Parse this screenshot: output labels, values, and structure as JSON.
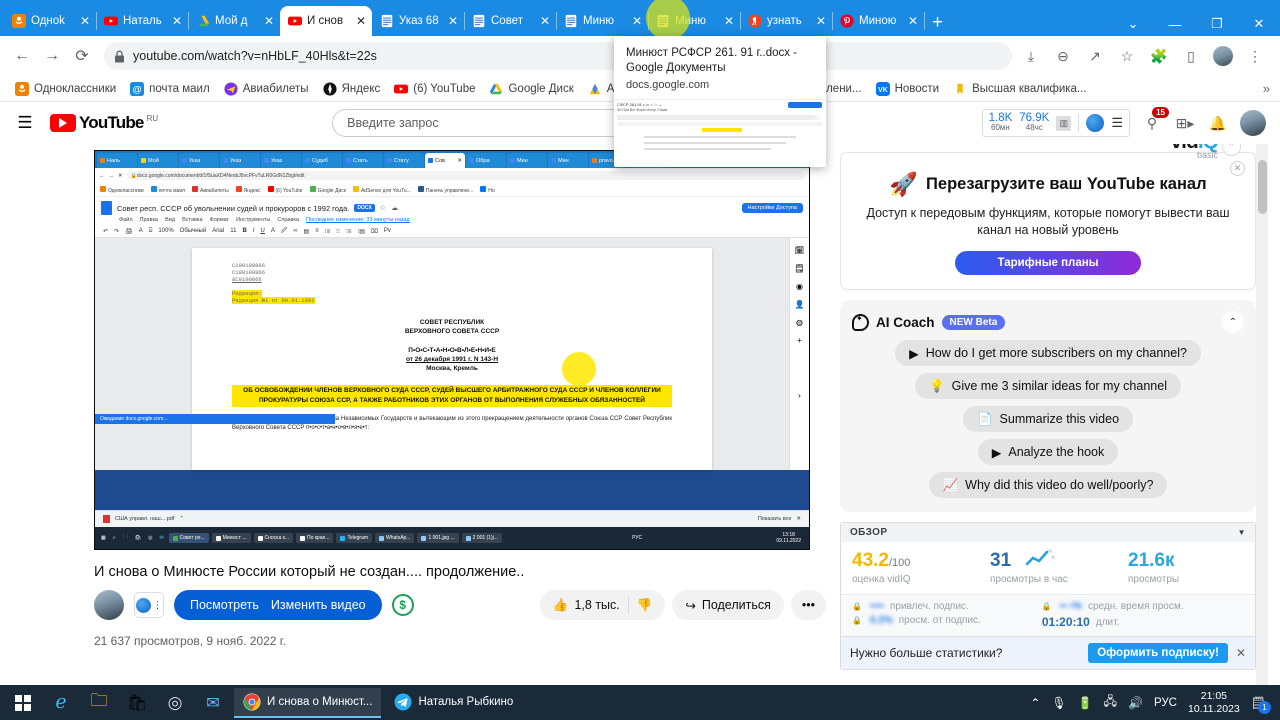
{
  "browser": {
    "tabs": [
      {
        "title": "Одноk",
        "icon": "ok-icon"
      },
      {
        "title": "Наталь",
        "icon": "youtube-icon"
      },
      {
        "title": "Мой д",
        "icon": "gdrive-icon"
      },
      {
        "title": "И снов",
        "icon": "youtube-icon",
        "active": true
      },
      {
        "title": "Указ 68",
        "icon": "gdocs-icon"
      },
      {
        "title": "Совет",
        "icon": "gdocs-icon"
      },
      {
        "title": "Миню",
        "icon": "gdocs-icon",
        "hovered": true
      },
      {
        "title": "Миню",
        "icon": "gdocs-icon"
      },
      {
        "title": "узнать",
        "icon": "yandex-icon"
      },
      {
        "title": "Миною",
        "icon": "pinterest-icon"
      }
    ],
    "new_tab_label": "+",
    "window_controls": [
      "⌄",
      "—",
      "❐",
      "✕"
    ],
    "url": "youtube.com/watch?v=nHbLF_40Hls&t=22s",
    "nav": {
      "back": "←",
      "forward": "→",
      "reload": "⟳",
      "lock": "🔒"
    },
    "toolbar_icons": [
      "downloads-icon",
      "zoom-out-icon",
      "share-icon",
      "bookmark-star-icon",
      "extensions-icon",
      "sidepanel-icon",
      "profile-avatar",
      "chrome-menu-icon"
    ],
    "bookmarks": [
      {
        "label": "Одноклассники",
        "icon": "ok-icon"
      },
      {
        "label": "почта маил",
        "icon": "mail-icon"
      },
      {
        "label": "Авиабилеты",
        "icon": "plane-icon"
      },
      {
        "label": "Яндекс",
        "icon": "yandex-icon"
      },
      {
        "label": "(6) YouTube",
        "icon": "youtube-icon"
      },
      {
        "label": "Google Диск",
        "icon": "gdrive-icon"
      },
      {
        "label": "Adsense для YouTu...",
        "icon": "adsense-icon"
      },
      {
        "label": "Панель управлени...",
        "icon": "panel-icon"
      },
      {
        "label": "Новости",
        "icon": "vk-icon"
      },
      {
        "label": "Высшая квалифика...",
        "icon": "bookmark-icon"
      }
    ],
    "bookmarks_overflow": "»"
  },
  "tab_preview": {
    "title": "Минюст РСФСР 261. 91 г..docx - Google Документы",
    "url": "docs.google.com"
  },
  "youtube": {
    "menu_icon": "hamburger-icon",
    "logo_text": "YouTube",
    "logo_region": "RU",
    "search_placeholder": "Введите запрос",
    "search_value": "",
    "vidiq_stats": [
      {
        "value": "1.8K",
        "label": "60мн"
      },
      {
        "value": "76.9K",
        "label": "48чс"
      }
    ],
    "header_icons": [
      "vidiq-chart-icon",
      "vidiq-logo-icon",
      "vidiq-menu-icon",
      "upload-icon",
      "create-video-icon",
      "notifications-icon",
      "account-avatar"
    ],
    "notification_count": "15"
  },
  "video": {
    "title": "И снова о Минюсте России который не создан.... продолжение..",
    "watch_button": "Посмотреть",
    "edit_button": "Изменить видео",
    "monetize_icon": "dollar-icon",
    "likes": "1,8 тыс.",
    "dislike_icon": "thumbs-down-icon",
    "share_label": "Поделиться",
    "more_icon": "more-horizontal-icon",
    "views_line": "21 637 просмотров, 9 нояб. 2022 г."
  },
  "inner_recording": {
    "tabs": [
      "Наль",
      "Мой",
      "Указ",
      "Указ",
      "Указ",
      "Судеб",
      "Стать",
      "Стату",
      "Сов",
      "Обра",
      "Мин",
      "Мин",
      "pravo.",
      "Уп"
    ],
    "url": "docs.google.com/document/d/1fSuaXD4NeobJ5vcPFvTuLR0GdN1Zbgl/edit",
    "bookmarks": [
      "Одноклассники",
      "почта маил",
      "Авиабилеты",
      "Яндекс",
      "(6) YouTube",
      "Google Диск",
      "AdSense для YouTu...",
      "Панель управлени...",
      "Но"
    ],
    "doc_title": "Совет респ. СССР об увольнении судей и прокуроров с 1992 года.",
    "doc_badge": "DOCX",
    "doc_menus": [
      "Файл",
      "Правка",
      "Вид",
      "Вставка",
      "Формат",
      "Инструменты",
      "Справка"
    ],
    "doc_last_edit": "Последнее изменение: 33 минуты назад",
    "ribbon": [
      "↶",
      "↷",
      "🖨",
      "A",
      "⌸",
      "100%",
      "Обычный",
      "Arial",
      "11",
      "B",
      "I",
      "U",
      "A",
      "🖉",
      "∞",
      "▤",
      "≡",
      "⁝≡",
      "⁝⁝",
      "⁝≡",
      "⁝▤",
      "⌧",
      "Pv"
    ],
    "share_button": "Настройки Доступа",
    "doc_codes": [
      "C199100866",
      "C199100866",
      "&C9100866"
    ],
    "doc_edition": [
      "Редакция:",
      "Редакция №1 от 09.01.1992"
    ],
    "doc_heading": [
      "СОВЕТ РЕСПУБЛИК",
      "ВЕРХОВНОГО СОВЕТА СССР"
    ],
    "doc_post": "П•О•С•Т•А•Н•О•В•Л•Е•Н•И•Е",
    "doc_date": "от 26 декабря 1991 г. N 143-Н",
    "doc_place": "Москва, Кремль",
    "doc_subject": "ОБ ОСВОБОЖДЕНИИ ЧЛЕНОВ ВЕРХОВНОГО СУДА СССР, СУДЕЙ ВЫСШЕГО АРБИТРАЖНОГО СУДА СССР  И ЧЛЕНОВ КОЛЛЕГИИ ПРОКУРАТУРЫ СОЮЗА ССР, А ТАКЖЕ РАБОТНИКОВ ЭТИХ ОРГАНОВ ОТ ВЫПОЛНЕНИЯ СЛУЖЕБНЫХ ОБЯЗАННОСТЕЙ",
    "doc_body": "В связи с образованием Содружества Независимых Государств и вытекающим из этого прекращением деятельности органов Союза ССР Совет Республик Верховного Совета СССР п•о•с•т•а•н•о•в•л•я•е•т:",
    "status_text": "Ожидание docs.google.com...",
    "download_item": "США управл. наш....pdf",
    "download_show_all": "Показать все",
    "taskbar_items": [
      "Совет ре...",
      "Минюст ...",
      "Сноска к...",
      "По крае...",
      "Telegram",
      "WhatsAp...",
      "1 001.jpg ...",
      "2 001 (1)j..."
    ],
    "taskbar_lang": "РУС",
    "taskbar_time": "13:18",
    "taskbar_date": "09.11.2022"
  },
  "vidiq_promo": {
    "brand": "vid",
    "brand_accent": "IQ",
    "plan": "basic",
    "collapse_icon": "chevron-up-icon",
    "close_icon": "close-icon",
    "rocket_icon": "rocket-icon",
    "title": "Перезагрузите ваш YouTube канал",
    "subtitle": "Доступ к передовым функциям, которые помогут вывести ваш канал на новый уровень",
    "cta": "Тарифные планы"
  },
  "ai_coach": {
    "icon": "ai-coach-icon",
    "title": "AI Coach",
    "badge": "NEW Beta",
    "collapse_icon": "chevron-up-icon",
    "chips": [
      {
        "label": "How do I get more subscribers on my channel?",
        "icon": "video-icon"
      },
      {
        "label": "Give me 3 similar ideas for my channel",
        "icon": "bulb-icon"
      },
      {
        "label": "Summarize this video",
        "icon": "document-icon"
      },
      {
        "label": "Analyze the hook",
        "icon": "video-icon"
      },
      {
        "label": "Why did this video do well/poorly?",
        "icon": "chart-line-icon"
      }
    ]
  },
  "stats_panel": {
    "header": "ОБЗОР",
    "dropdown_icon": "chevron-down-icon",
    "cells": [
      {
        "value": "43.2",
        "suffix": "/100",
        "label": "оценка vidIQ",
        "color": "#f5b800"
      },
      {
        "value": "31",
        "suffix": "",
        "label": "просмотры в час",
        "color": "#2b6cb0"
      },
      {
        "value": "21.6к",
        "suffix": "",
        "label": "просмотры",
        "color": "#2aa7df"
      }
    ],
    "locked_rows": [
      {
        "value": "••••",
        "label": "привлеч. подпис."
      },
      {
        "value": "0.2%",
        "label": "просм. от подпис."
      },
      {
        "value": "•• •%",
        "label": "средн. время просм."
      },
      {
        "value": "01:20:10",
        "label": "длит."
      }
    ],
    "banner_text": "Нужно больше статистики?",
    "banner_cta": "Оформить подписку!",
    "banner_close": "✕"
  },
  "taskbar": {
    "start_icon": "windows-icon",
    "pinned": [
      "edge-icon",
      "explorer-icon",
      "store-icon",
      "obs-icon",
      "mail-icon"
    ],
    "apps": [
      {
        "label": "И снова о Минюст...",
        "icon": "chrome-icon"
      },
      {
        "label": "Наталья Рыбкино",
        "icon": "telegram-icon"
      }
    ],
    "tray_icons": [
      "show-hidden-icon",
      "microphone-icon",
      "battery-icon",
      "network-icon",
      "volume-icon"
    ],
    "language": "РУС",
    "time": "21:05",
    "date": "10.11.2023",
    "notifications_icon": "notifications-icon",
    "notifications_count": "1"
  }
}
